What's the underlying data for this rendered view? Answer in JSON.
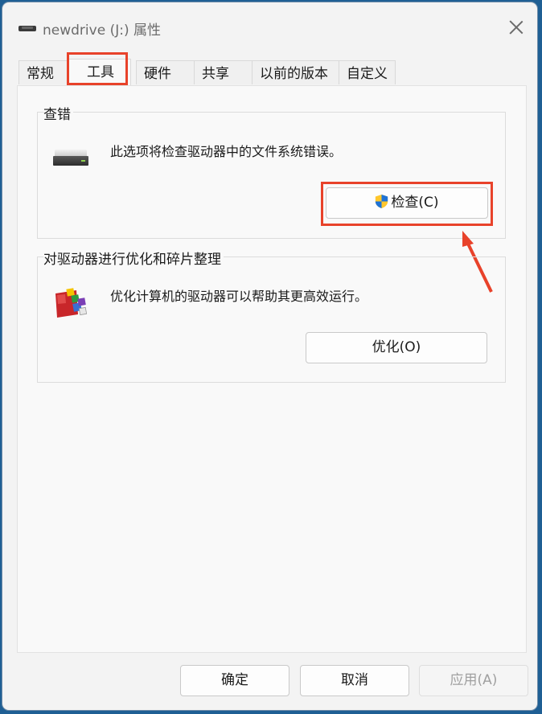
{
  "window": {
    "title": "newdrive (J:) 属性"
  },
  "tabs": [
    {
      "label": "常规",
      "active": false
    },
    {
      "label": "工具",
      "active": true
    },
    {
      "label": "硬件",
      "active": false
    },
    {
      "label": "共享",
      "active": false
    },
    {
      "label": "以前的版本",
      "active": false
    },
    {
      "label": "自定义",
      "active": false
    }
  ],
  "error_check": {
    "title": "查错",
    "icon": "hard-drive-icon",
    "description": "此选项将检查驱动器中的文件系统错误。",
    "button_label": "检查(C)",
    "button_icon": "uac-shield-icon"
  },
  "optimize": {
    "title": "对驱动器进行优化和碎片整理",
    "icon": "defrag-icon",
    "description": "优化计算机的驱动器可以帮助其更高效运行。",
    "button_label": "优化(O)"
  },
  "footer": {
    "ok_label": "确定",
    "cancel_label": "取消",
    "apply_label": "应用(A)"
  },
  "annotation_colors": {
    "highlight": "#e8422a"
  }
}
